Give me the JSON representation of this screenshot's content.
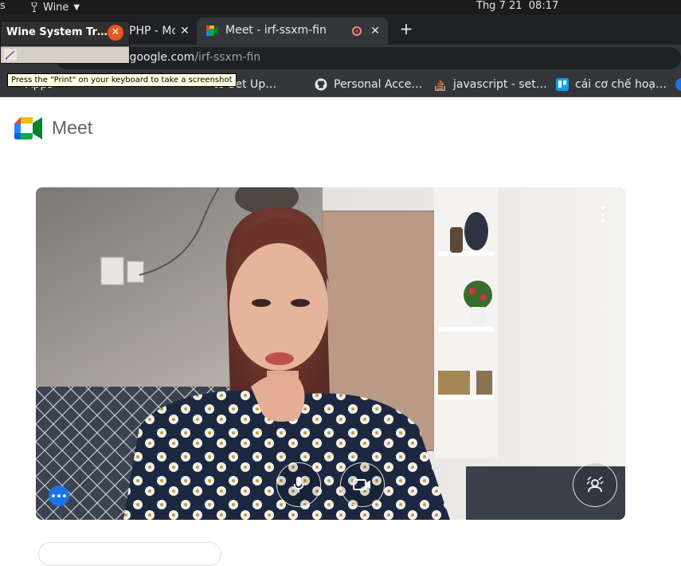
{
  "system_bar": {
    "app_name": "Wine",
    "clock": "Thg 7 21  08:17"
  },
  "tabs": [
    {
      "title": "PHP - Mc",
      "close": "✕"
    },
    {
      "title": "Meet - irf-ssxm-fin",
      "close": "✕",
      "recording": true
    }
  ],
  "new_tab": "+",
  "address_bar": {
    "host": "et.google.com",
    "path": "/irf-ssxm-fin"
  },
  "bookmarks": [
    {
      "label": "Apps",
      "icon": "apps-grid-icon"
    },
    {
      "label": "to Set Up…",
      "icon": "bookmark-icon"
    },
    {
      "label": "Personal Acce…",
      "icon": "github-icon"
    },
    {
      "label": "javascript - set…",
      "icon": "stackoverflow-icon"
    },
    {
      "label": "cái cơ chế hoạ…",
      "icon": "trello-icon"
    }
  ],
  "wine_tray": {
    "title": "Wine System Tr…",
    "tooltip": "Press the \"Print\" on your keyboard to take a screenshot"
  },
  "meet": {
    "brand": "Meet",
    "controls": {
      "mic_icon": "microphone-icon",
      "camera_icon": "video-camera-icon",
      "background_icon": "background-effects-icon",
      "more_icon": "more-options-icon"
    }
  },
  "colors": {
    "tab_strip": "#202124",
    "active_tab": "#35363a",
    "wine_close": "#e95420",
    "meet_blue": "#1a73e8",
    "recording": "#d93025"
  }
}
